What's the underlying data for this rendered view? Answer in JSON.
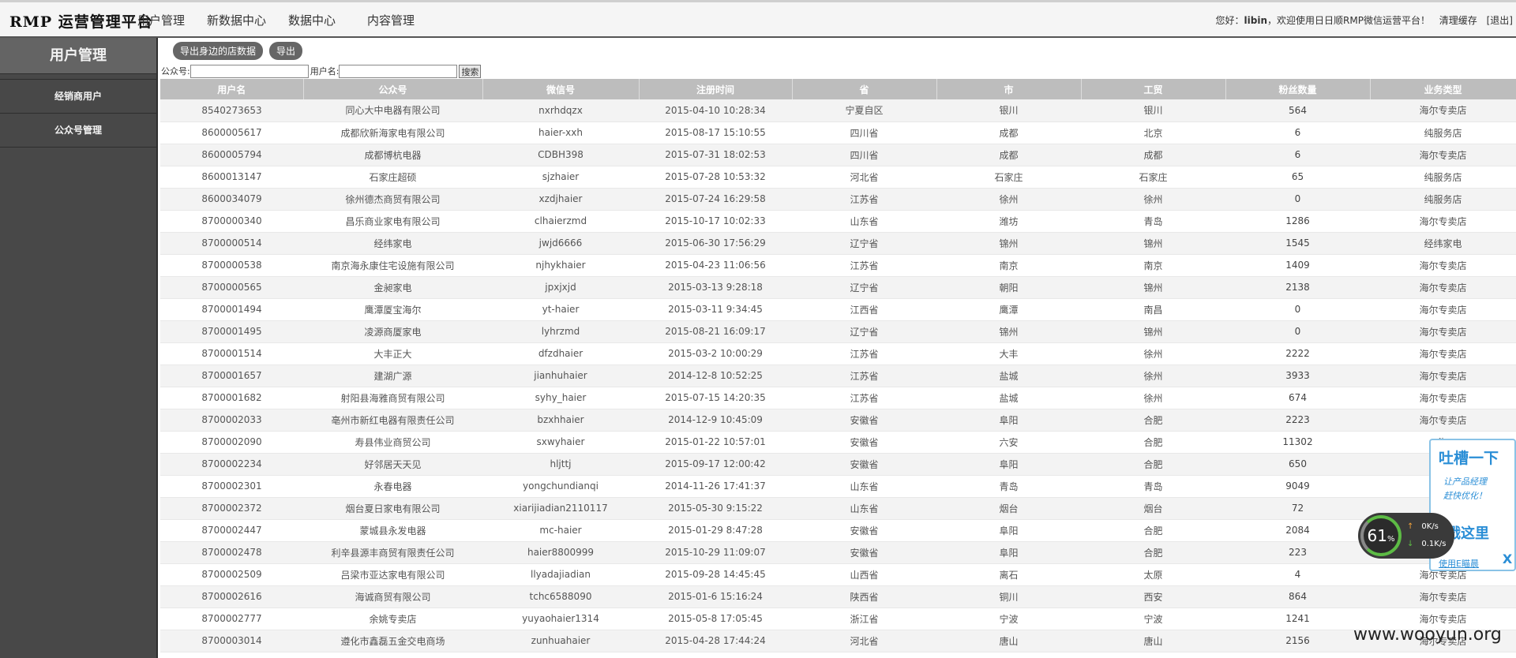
{
  "brand": "RMP 运营管理平台",
  "nav": [
    "用户管理",
    "新数据中心",
    "数据中心",
    "内容管理"
  ],
  "header": {
    "greeting_prefix": "您好：",
    "username": "libin",
    "greeting_suffix": "，欢迎使用日日顺RMP微信运营平台！",
    "clear_cache": "清理缓存",
    "logout": "[退出]"
  },
  "sidebar": {
    "title": "用户管理",
    "items": [
      "经销商用户",
      "公众号管理"
    ]
  },
  "toolbar": {
    "export_nearby": "导出身边的店数据",
    "export": "导出"
  },
  "search": {
    "account_label": "公众号:",
    "username_label": "用户名:",
    "button": "搜索",
    "account_value": "",
    "username_value": ""
  },
  "table": {
    "columns": [
      "用户名",
      "公众号",
      "微信号",
      "注册时间",
      "省",
      "市",
      "工贸",
      "粉丝数量",
      "业务类型"
    ],
    "rows": [
      [
        "8540273653",
        "同心大中电器有限公司",
        "nxrhdqzx",
        "2015-04-10 10:28:34",
        "宁夏自区",
        "银川",
        "银川",
        "564",
        "海尔专卖店"
      ],
      [
        "8600005617",
        "成都欣新海家电有限公司",
        "haier-xxh",
        "2015-08-17 15:10:55",
        "四川省",
        "成都",
        "北京",
        "6",
        "纯服务店"
      ],
      [
        "8600005794",
        "成都博杭电器",
        "CDBH398",
        "2015-07-31 18:02:53",
        "四川省",
        "成都",
        "成都",
        "6",
        "海尔专卖店"
      ],
      [
        "8600013147",
        "石家庄超硕",
        "sjzhaier",
        "2015-07-28 10:53:32",
        "河北省",
        "石家庄",
        "石家庄",
        "65",
        "纯服务店"
      ],
      [
        "8600034079",
        "徐州德杰商贸有限公司",
        "xzdjhaier",
        "2015-07-24 16:29:58",
        "江苏省",
        "徐州",
        "徐州",
        "0",
        "纯服务店"
      ],
      [
        "8700000340",
        "昌乐商业家电有限公司",
        "clhaierzmd",
        "2015-10-17 10:02:33",
        "山东省",
        "潍坊",
        "青岛",
        "1286",
        "海尔专卖店"
      ],
      [
        "8700000514",
        "经纬家电",
        "jwjd6666",
        "2015-06-30 17:56:29",
        "辽宁省",
        "锦州",
        "锦州",
        "1545",
        "经纬家电"
      ],
      [
        "8700000538",
        "南京海永康住宅设施有限公司",
        "njhykhaier",
        "2015-04-23 11:06:56",
        "江苏省",
        "南京",
        "南京",
        "1409",
        "海尔专卖店"
      ],
      [
        "8700000565",
        "金昶家电",
        "jpxjxjd",
        "2015-03-13 9:28:18",
        "辽宁省",
        "朝阳",
        "锦州",
        "2138",
        "海尔专卖店"
      ],
      [
        "8700001494",
        "鹰潭厦宝海尔",
        "yt-haier",
        "2015-03-11 9:34:45",
        "江西省",
        "鹰潭",
        "南昌",
        "0",
        "海尔专卖店"
      ],
      [
        "8700001495",
        "凌源商厦家电",
        "lyhrzmd",
        "2015-08-21 16:09:17",
        "辽宁省",
        "锦州",
        "锦州",
        "0",
        "海尔专卖店"
      ],
      [
        "8700001514",
        "大丰正大",
        "dfzdhaier",
        "2015-03-2 10:00:29",
        "江苏省",
        "大丰",
        "徐州",
        "2222",
        "海尔专卖店"
      ],
      [
        "8700001657",
        "建湖广源",
        "jianhuhaier",
        "2014-12-8 10:52:25",
        "江苏省",
        "盐城",
        "徐州",
        "3933",
        "海尔专卖店"
      ],
      [
        "8700001682",
        "射阳县海雅商贸有限公司",
        "syhy_haier",
        "2015-07-15 14:20:35",
        "江苏省",
        "盐城",
        "徐州",
        "674",
        "海尔专卖店"
      ],
      [
        "8700002033",
        "亳州市新红电器有限责任公司",
        "bzxhhaier",
        "2014-12-9 10:45:09",
        "安徽省",
        "阜阳",
        "合肥",
        "2223",
        "海尔专卖店"
      ],
      [
        "8700002090",
        "寿县伟业商贸公司",
        "sxwyhaier",
        "2015-01-22 10:57:01",
        "安徽省",
        "六安",
        "合肥",
        "11302",
        "海"
      ],
      [
        "8700002234",
        "好邻居天天见",
        "hljttj",
        "2015-09-17 12:00:42",
        "安徽省",
        "阜阳",
        "合肥",
        "650",
        "海"
      ],
      [
        "8700002301",
        "永春电器",
        "yongchundianqi",
        "2014-11-26 17:41:37",
        "山东省",
        "青岛",
        "青岛",
        "9049",
        "海"
      ],
      [
        "8700002372",
        "烟台夏日家电有限公司",
        "xiarijiadian2110117",
        "2015-05-30 9:15:22",
        "山东省",
        "烟台",
        "烟台",
        "72",
        "海"
      ],
      [
        "8700002447",
        "蒙城县永发电器",
        "mc-haier",
        "2015-01-29 8:47:28",
        "安徽省",
        "阜阳",
        "合肥",
        "2084",
        ""
      ],
      [
        "8700002478",
        "利辛县源丰商贸有限责任公司",
        "haier8800999",
        "2015-10-29 11:09:07",
        "安徽省",
        "阜阳",
        "合肥",
        "223",
        ""
      ],
      [
        "8700002509",
        "吕梁市亚达家电有限公司",
        "llyadajiadian",
        "2015-09-28 14:45:45",
        "山西省",
        "离石",
        "太原",
        "4",
        "海尔专卖店"
      ],
      [
        "8700002616",
        "海诚商贸有限公司",
        "tchc6588090",
        "2015-01-6 15:16:24",
        "陕西省",
        "铜川",
        "西安",
        "864",
        "海尔专卖店"
      ],
      [
        "8700002777",
        "余姚专卖店",
        "yuyaohaier1314",
        "2015-05-8 17:05:45",
        "浙江省",
        "宁波",
        "宁波",
        "1241",
        "海尔专卖店"
      ],
      [
        "8700003014",
        "遵化市鑫磊五金交电商场",
        "zunhuahaier",
        "2015-04-28 17:44:24",
        "河北省",
        "唐山",
        "唐山",
        "2156",
        "海尔专卖店"
      ]
    ]
  },
  "feedback": {
    "title": "吐槽一下",
    "sub1": "让产品经理",
    "sub2": "赶快优化！",
    "click": "戳这里",
    "link": "使用E瞄晨",
    "close": "X"
  },
  "speed": {
    "percent": "61",
    "unit": "%",
    "up": "0K/s",
    "down": "0.1K/s",
    "up_arrow": "↑",
    "down_arrow": "↓"
  },
  "watermark": "www.wooyun.org",
  "colors": {
    "header_bg": "#bdbdbd",
    "sidebar_bg": "#484848",
    "accent": "#2a8ed6"
  }
}
